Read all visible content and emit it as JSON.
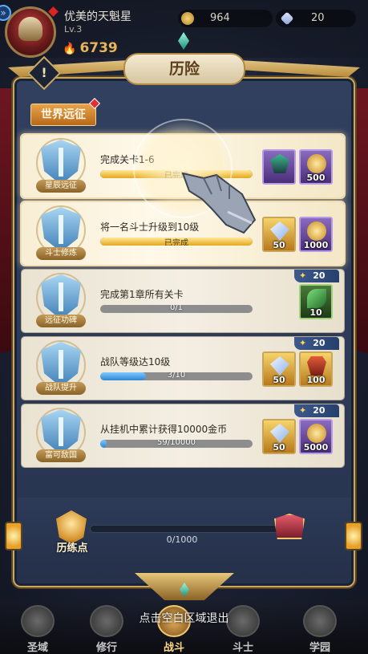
{
  "hud": {
    "player_name": "优美的天魁星",
    "level": "Lv.3",
    "power": "6739",
    "gold": "964",
    "gems": "20"
  },
  "panel": {
    "title": "历险",
    "info_label": "!",
    "tab": "世界远征"
  },
  "quests": [
    {
      "badge_label": "星辰远征",
      "title": "完成关卡1-6",
      "progress_text": "已完成",
      "progress": 1.0,
      "completed": true,
      "points": "",
      "rewards": [
        {
          "icon": "helmet-icon",
          "qty": ""
        },
        {
          "icon": "gold-coin-icon",
          "qty": "500"
        }
      ]
    },
    {
      "badge_label": "斗士修炼",
      "title": "将一名斗士升级到10级",
      "progress_text": "已完成",
      "progress": 1.0,
      "completed": true,
      "points": "",
      "rewards": [
        {
          "icon": "diamond-icon",
          "qty": "50"
        },
        {
          "icon": "gold-coin-icon",
          "qty": "1000"
        }
      ]
    },
    {
      "badge_label": "远征功碑",
      "title": "完成第1章所有关卡",
      "progress_text": "0/1",
      "progress": 0.0,
      "completed": false,
      "points": "20",
      "rewards": [
        {
          "icon": "leaf-icon",
          "qty": "10"
        }
      ]
    },
    {
      "badge_label": "战队提升",
      "title": "战队等级达10级",
      "progress_text": "3/10",
      "progress": 0.3,
      "completed": false,
      "points": "20",
      "rewards": [
        {
          "icon": "diamond-icon",
          "qty": "50"
        },
        {
          "icon": "armor-icon",
          "qty": "100"
        }
      ]
    },
    {
      "badge_label": "富可敌国",
      "title": "从挂机中累计获得10000金币",
      "progress_text": "59/10000",
      "progress": 0.0059,
      "completed": false,
      "points": "20",
      "rewards": [
        {
          "icon": "diamond-icon",
          "qty": "50"
        },
        {
          "icon": "gold-coin-icon",
          "qty": "5000"
        }
      ]
    }
  ],
  "drill": {
    "label": "历练点",
    "progress_text": "0/1000",
    "progress": 0.0
  },
  "exit_hint": "点击空白区域退出",
  "nav": [
    {
      "label": "圣域",
      "icon": "temple-icon",
      "active": false
    },
    {
      "label": "修行",
      "icon": "cards-icon",
      "active": false
    },
    {
      "label": "战斗",
      "icon": "battle-icon",
      "active": true
    },
    {
      "label": "斗士",
      "icon": "warrior-icon",
      "active": false
    },
    {
      "label": "学园",
      "icon": "academy-icon",
      "active": false
    }
  ]
}
